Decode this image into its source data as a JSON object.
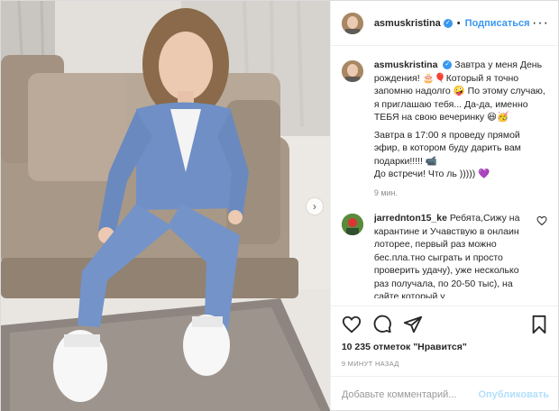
{
  "header": {
    "username": "asmuskristina",
    "separator": "•",
    "follow_label": "Подписаться",
    "more_icon": "more-dots-icon"
  },
  "caption": {
    "username": "asmuskristina",
    "text_line1": "Завтра у меня День рождения! 🎂🎈Который я точно запомню надолго 🤪 По этому случаю, я приглашаю тебя... Да-да, именно ТЕБЯ на свою вечеринку 😆🥳",
    "text_line2": "Завтра в 17:00 я проведу прямой эфир, в котором буду дарить вам подарки!!!!! 📹",
    "text_line3": "До встречи! Что ль ))))) 💜",
    "time": "9 мин."
  },
  "comment": {
    "username": "jarrednton15_ke",
    "text": "Ребята,Сижу на карантине и Учавствую в онлаин лоторее, первый раз можно бес.пла.тно сыграть и просто проверить удачу), уже несколько раз получала, по 20-50 тыс), на сайте который у"
  },
  "actions": {
    "like_icon": "heart-icon",
    "comment_icon": "comment-icon",
    "share_icon": "share-icon",
    "save_icon": "bookmark-icon"
  },
  "likes_text": "10 235 отметок \"Нравится\"",
  "time_ago": "9 МИНУТ НАЗАД",
  "add_comment": {
    "placeholder": "Добавьте комментарий...",
    "publish_label": "Опубликовать"
  },
  "colors": {
    "accent": "#3897f0",
    "publish_disabled": "#b2dffc",
    "muted": "#8e8e8e",
    "suit": "#6f8fc6"
  }
}
